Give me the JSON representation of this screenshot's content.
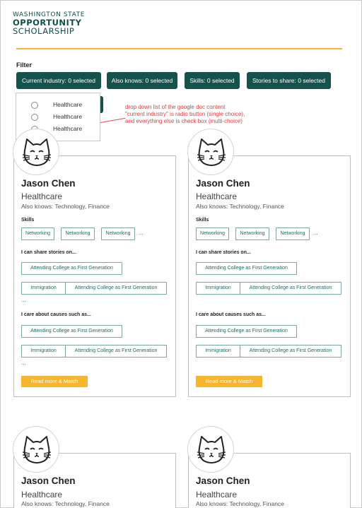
{
  "logo": {
    "line1": "WASHINGTON STATE",
    "line2": "OPPORTUNITY",
    "line3": "SCHOLARSHIP"
  },
  "filter": {
    "label": "Filter",
    "buttons": [
      "Current industry: 0 selected",
      "Also knows: 0 selected",
      "Skills: 0 selected",
      "Stories to share: 0 selected"
    ]
  },
  "dropdown": {
    "options": [
      "Healthcare",
      "Healthcare",
      "Healthcare"
    ]
  },
  "annotation": {
    "line1": "drop down list of the google doc content",
    "line2": "\"current industry\" is radio button (single choice),",
    "line3": "and everything else is check box (multi-choice)"
  },
  "card": {
    "name": "Jason Chen",
    "industry": "Healthcare",
    "also_knows": "Also knows: Technology, Finance",
    "skills_title": "Skills",
    "skills": [
      "Networking",
      "Networking",
      "Networking"
    ],
    "ellipsis": "...",
    "stories_title": "I can share stories on...",
    "stories": [
      "Attending College as First Generation",
      "Immigration",
      "Attending College as First Generation"
    ],
    "causes_title": "I care about causes such as...",
    "causes": [
      "Attending College as First Generation",
      "Immigration",
      "Attending College as First Generation"
    ],
    "cta": "Read more & Match"
  },
  "colors": {
    "brand": "#16524c",
    "accent": "#f7b42e",
    "annotation": "#e23c3c"
  },
  "icons": {
    "avatar": "cat-face-icon",
    "radio": "radio-button-icon"
  }
}
